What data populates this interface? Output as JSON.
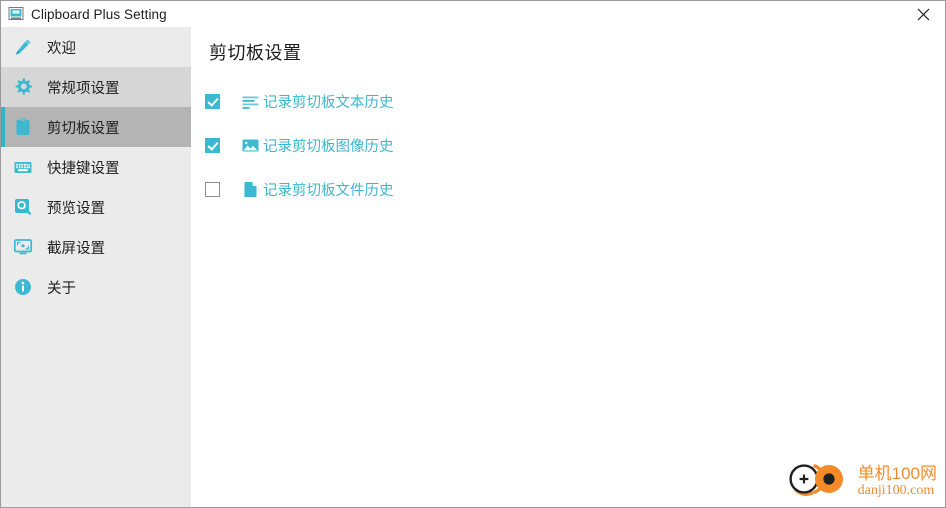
{
  "window": {
    "title": "Clipboard Plus Setting",
    "title_icon": "clipboard-app-icon",
    "close_label": "×"
  },
  "colors": {
    "accent": "#3cb8d0",
    "accent_bar": "#2fb6ce",
    "sidebar_bg": "#ebebeb",
    "sidebar_hover": "#d6d6d6",
    "sidebar_selected": "#b4b4b4",
    "content_bg": "#ffffff",
    "watermark": "#f08a2a",
    "text": "#1d1d1d"
  },
  "sidebar": {
    "items": [
      {
        "label": "欢迎",
        "icon": "pen-icon",
        "state": "normal"
      },
      {
        "label": "常规项设置",
        "icon": "gear-icon",
        "state": "hovered"
      },
      {
        "label": "剪切板设置",
        "icon": "clipboard-icon",
        "state": "selected"
      },
      {
        "label": "快捷键设置",
        "icon": "keyboard-icon",
        "state": "normal"
      },
      {
        "label": "预览设置",
        "icon": "preview-search-icon",
        "state": "normal"
      },
      {
        "label": "截屏设置",
        "icon": "monitor-capture-icon",
        "state": "normal"
      },
      {
        "label": "关于",
        "icon": "info-icon",
        "state": "normal"
      }
    ]
  },
  "main": {
    "page_title": "剪切板设置",
    "options": [
      {
        "label": "记录剪切板文本历史",
        "icon": "text-lines-icon",
        "checked": true
      },
      {
        "label": "记录剪切板图像历史",
        "icon": "image-icon",
        "checked": true
      },
      {
        "label": "记录剪切板文件历史",
        "icon": "file-icon",
        "checked": false
      }
    ]
  },
  "watermark": {
    "cn": "单机100网",
    "en": "danji100.com",
    "logo": "danji100-logo"
  }
}
